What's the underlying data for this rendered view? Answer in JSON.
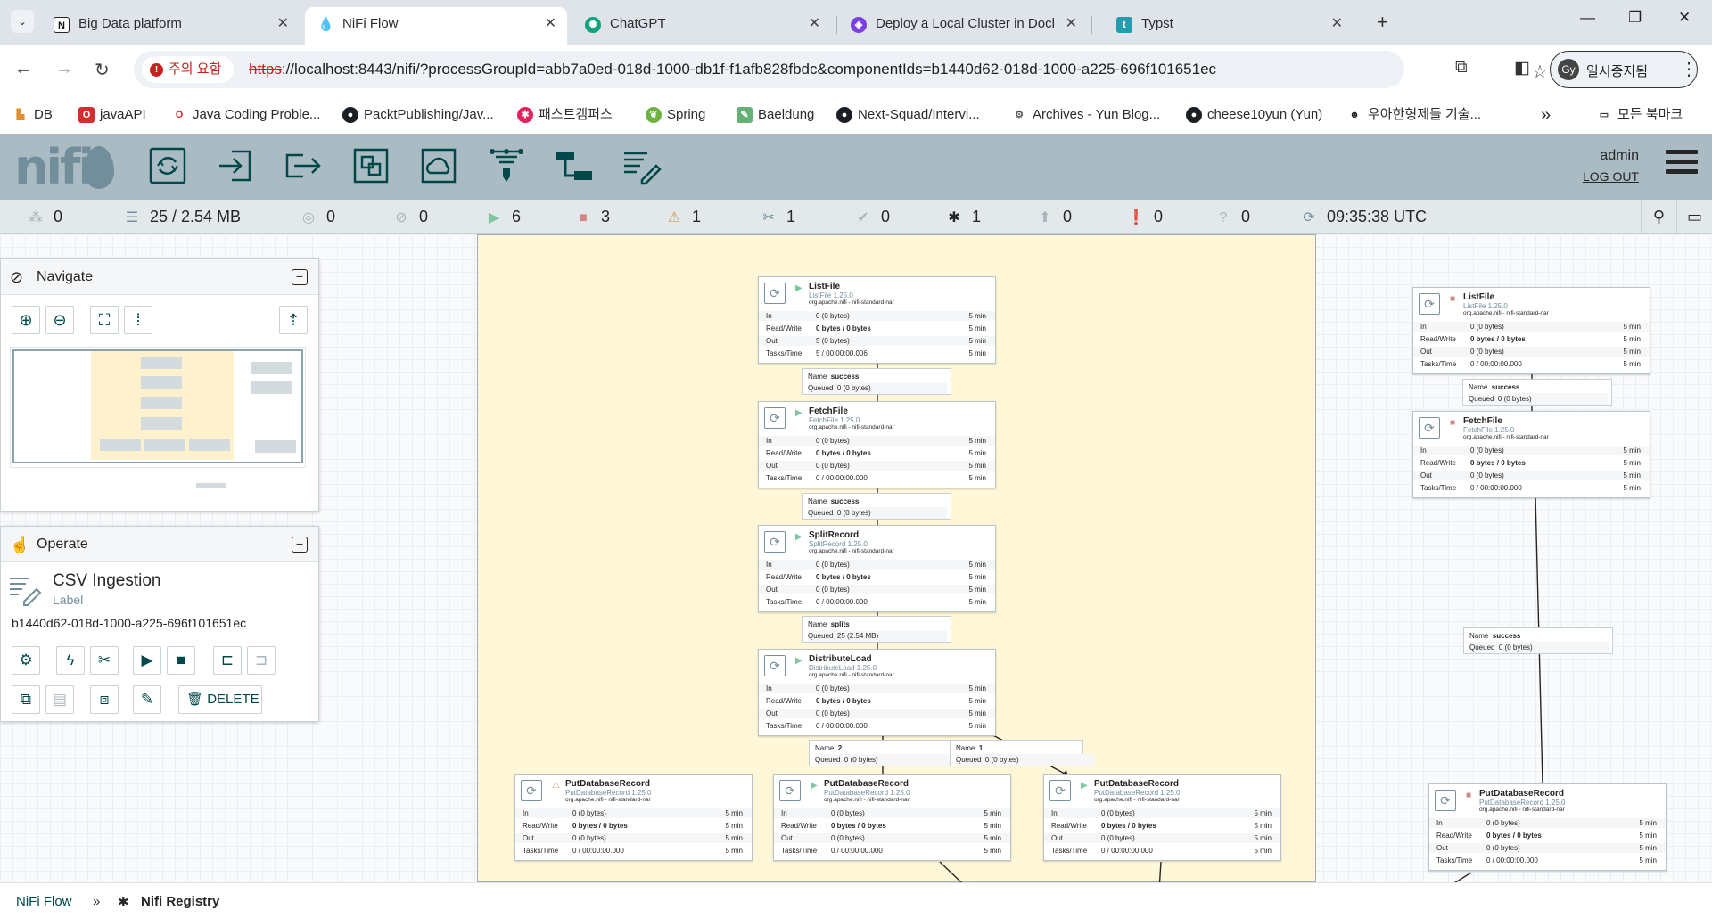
{
  "browser": {
    "tabs": [
      {
        "title": "Big Data platform",
        "favicon": "notion-icon",
        "active": false
      },
      {
        "title": "NiFi Flow",
        "favicon": "nifi-icon",
        "active": true
      },
      {
        "title": "ChatGPT",
        "favicon": "chatgpt-icon",
        "active": false
      },
      {
        "title": "Deploy a Local Cluster in Dock",
        "favicon": "shield-icon",
        "active": false
      },
      {
        "title": "Typst",
        "favicon": "typst-icon",
        "active": false
      }
    ],
    "address": {
      "security_label": "주의 요함",
      "url_scheme": "https",
      "url_rest": "://localhost:8443/nifi/?processGroupId=abb7a0ed-018d-1000-db1f-f1afb828fbdc&componentIds=b1440d62-018d-1000-a225-696f101651ec"
    },
    "profile": {
      "initials": "Gy",
      "label": "일시중지됨"
    },
    "bookmarks": [
      "DB",
      "javaAPI",
      "Java Coding Proble...",
      "PacktPublishing/Jav...",
      "패스트캠퍼스",
      "Spring",
      "Baeldung",
      "Next-Squad/Intervi...",
      "Archives - Yun Blog...",
      "cheese10yun (Yun)",
      "우아한형제들 기술..."
    ],
    "bookmarks_overflow": "»",
    "all_bookmarks": "모든 북마크"
  },
  "nifi": {
    "user": "admin",
    "logout": "LOG OUT",
    "status": {
      "active_threads": "0",
      "queued": "25 / 2.54 MB",
      "transmitting": "0",
      "not_transmitting": "0",
      "running": "6",
      "stopped": "3",
      "invalid": "1",
      "disabled": "1",
      "up_to_date": "0",
      "locally_modified": "1",
      "stale": "0",
      "sync_failure": "0",
      "unknown": "0",
      "refresh_time": "09:35:38 UTC"
    },
    "navigate_title": "Navigate",
    "operate": {
      "title": "Operate",
      "component_name": "CSV Ingestion",
      "component_type": "Label",
      "component_id": "b1440d62-018d-1000-a225-696f101651ec",
      "delete_label": "DELETE"
    },
    "row_labels": {
      "in": "In",
      "rw": "Read/Write",
      "out": "Out",
      "tasks": "Tasks/Time",
      "interval": "5 min"
    },
    "conn_labels": {
      "name": "Name",
      "queued": "Queued"
    },
    "processors": [
      {
        "name": "ListFile",
        "type": "ListFile 1.25.0",
        "bundle": "org.apache.nifi - nifi-standard-nar",
        "state": "running",
        "in": "0 (0 bytes)",
        "rw": "0 bytes / 0 bytes",
        "out": "5 (0 bytes)",
        "tasks": "5 / 00:00:00.006"
      },
      {
        "name": "FetchFile",
        "type": "FetchFile 1.25.0",
        "bundle": "org.apache.nifi - nifi-standard-nar",
        "state": "running",
        "in": "0 (0 bytes)",
        "rw": "0 bytes / 0 bytes",
        "out": "0 (0 bytes)",
        "tasks": "0 / 00:00:00.000"
      },
      {
        "name": "SplitRecord",
        "type": "SplitRecord 1.25.0",
        "bundle": "org.apache.nifi - nifi-standard-nar",
        "state": "running",
        "in": "0 (0 bytes)",
        "rw": "0 bytes / 0 bytes",
        "out": "0 (0 bytes)",
        "tasks": "0 / 00:00:00.000"
      },
      {
        "name": "DistributeLoad",
        "type": "DistributeLoad 1.25.0",
        "bundle": "org.apache.nifi - nifi-standard-nar",
        "state": "running",
        "in": "0 (0 bytes)",
        "rw": "0 bytes / 0 bytes",
        "out": "0 (0 bytes)",
        "tasks": "0 / 00:00:00.000"
      },
      {
        "name": "PutDatabaseRecord",
        "type": "PutDatabaseRecord 1.25.0",
        "bundle": "org.apache.nifi - nifi-standard-nar",
        "state": "invalid",
        "in": "0 (0 bytes)",
        "rw": "0 bytes / 0 bytes",
        "out": "0 (0 bytes)",
        "tasks": "0 / 00:00:00.000"
      },
      {
        "name": "PutDatabaseRecord",
        "type": "PutDatabaseRecord 1.25.0",
        "bundle": "org.apache.nifi - nifi-standard-nar",
        "state": "running",
        "in": "0 (0 bytes)",
        "rw": "0 bytes / 0 bytes",
        "out": "0 (0 bytes)",
        "tasks": "0 / 00:00:00.000"
      },
      {
        "name": "PutDatabaseRecord",
        "type": "PutDatabaseRecord 1.25.0",
        "bundle": "org.apache.nifi - nifi-standard-nar",
        "state": "running",
        "in": "0 (0 bytes)",
        "rw": "0 bytes / 0 bytes",
        "out": "0 (0 bytes)",
        "tasks": "0 / 00:00:00.000"
      },
      {
        "name": "ListFile",
        "type": "ListFile 1.25.0",
        "bundle": "org.apache.nifi - nifi-standard-nar",
        "state": "stopped",
        "in": "0 (0 bytes)",
        "rw": "0 bytes / 0 bytes",
        "out": "0 (0 bytes)",
        "tasks": "0 / 00:00:00.000"
      },
      {
        "name": "FetchFile",
        "type": "FetchFile 1.25.0",
        "bundle": "org.apache.nifi - nifi-standard-nar",
        "state": "stopped",
        "in": "0 (0 bytes)",
        "rw": "0 bytes / 0 bytes",
        "out": "0 (0 bytes)",
        "tasks": "0 / 00:00:00.000"
      },
      {
        "name": "PutDatabaseRecord",
        "type": "PutDatabaseRecord 1.25.0",
        "bundle": "org.apache.nifi - nifi-standard-nar",
        "state": "stopped",
        "in": "0 (0 bytes)",
        "rw": "0 bytes / 0 bytes",
        "out": "0 (0 bytes)",
        "tasks": "0 / 00:00:00.000"
      }
    ],
    "connections": [
      {
        "name": "success",
        "queued": "0 (0 bytes)"
      },
      {
        "name": "success",
        "queued": "0 (0 bytes)"
      },
      {
        "name": "splits",
        "queued": "25 (2.54 MB)"
      },
      {
        "name": "2",
        "queued": "0 (0 bytes)"
      },
      {
        "name": "1",
        "queued": "0 (0 bytes)"
      },
      {
        "name": "success",
        "queued": "0 (0 bytes)"
      },
      {
        "name": "success",
        "queued": "0 (0 bytes)"
      }
    ],
    "breadcrumbs": {
      "root": "NiFi Flow",
      "separator": "»",
      "current": "Nifi Registry"
    }
  },
  "colors": {
    "accent": "#004849",
    "header": "#aabbc3",
    "running": "#7dc7a0",
    "stopped": "#d18686",
    "invalid": "#cf9f5d",
    "label_bg": "#fff7d7"
  }
}
